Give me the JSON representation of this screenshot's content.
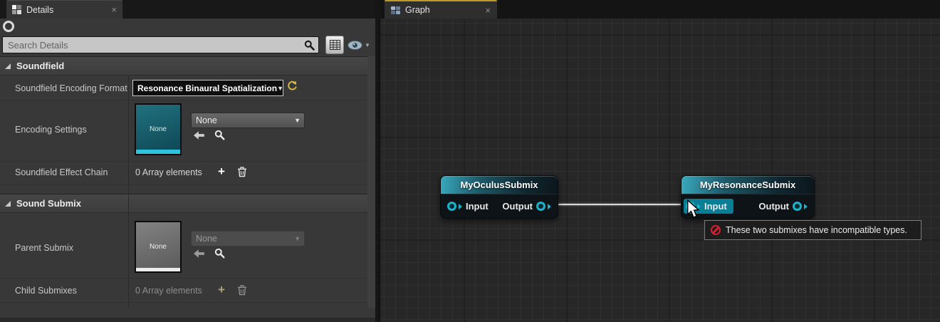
{
  "glyphs": {
    "close": "×",
    "caret": "▼",
    "plus": "+"
  },
  "colors": {
    "accent_teal": "#1ab4cd",
    "tab_underline_yellow": "#c09a26",
    "error_red": "#d2202e",
    "reset_yellow": "#d2b949"
  },
  "details_panel": {
    "tab_label": "Details",
    "search_placeholder": "Search Details",
    "sections": [
      {
        "title": "Soundfield",
        "rows": [
          {
            "label": "Soundfield Encoding Format",
            "value": "Resonance Binaural Spatialization"
          },
          {
            "label": "Encoding Settings",
            "thumbnail_text": "None",
            "dropdown_value": "None"
          },
          {
            "label": "Soundfield Effect Chain",
            "value": "0 Array elements"
          }
        ]
      },
      {
        "title": "Sound Submix",
        "rows": [
          {
            "label": "Parent Submix",
            "thumbnail_text": "None",
            "dropdown_value": "None"
          },
          {
            "label": "Child Submixes",
            "value": "0 Array elements"
          }
        ]
      }
    ]
  },
  "graph_panel": {
    "tab_label": "Graph",
    "nodes": [
      {
        "title": "MyOculusSubmix",
        "input_label": "Input",
        "output_label": "Output"
      },
      {
        "title": "MyResonanceSubmix",
        "input_label": "Input",
        "output_label": "Output"
      }
    ],
    "tooltip_text": "These two submixes have incompatible types."
  }
}
